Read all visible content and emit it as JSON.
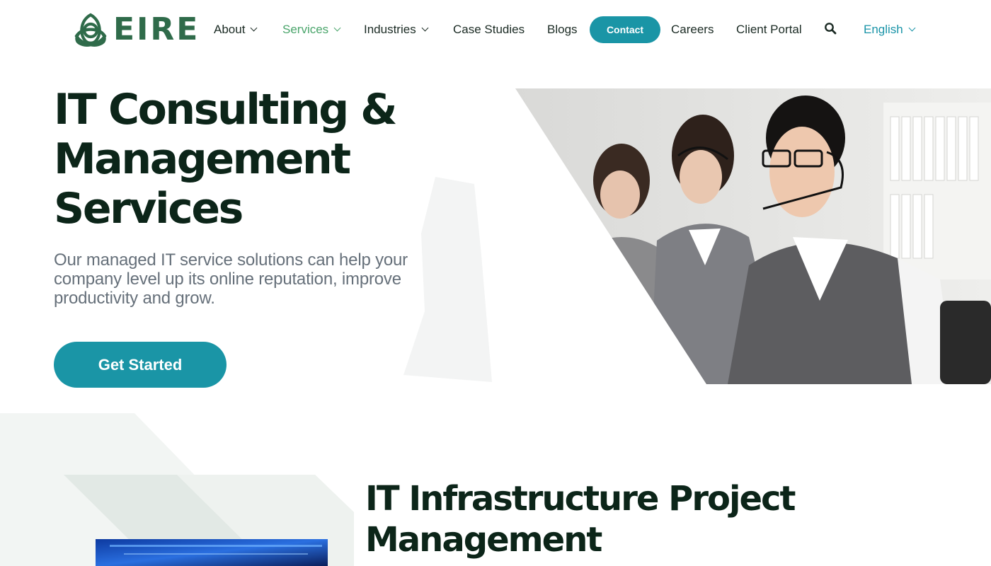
{
  "brand": {
    "name": "EIRE"
  },
  "nav": {
    "about": "About",
    "services": "Services",
    "industries": "Industries",
    "case_studies": "Case Studies",
    "blogs": "Blogs",
    "contact": "Contact",
    "careers": "Careers",
    "client_portal": "Client Portal",
    "language": "English"
  },
  "icons": {
    "search": "search-icon",
    "dropdown": "chevron-down-icon",
    "logo": "celtic-knot-icon"
  },
  "hero": {
    "title_lines": [
      "IT Consulting &",
      "Management",
      "Services"
    ],
    "subtitle": "Our managed IT service solutions can help your company level up its online reputation, improve productivity and grow.",
    "cta": "Get Started"
  },
  "section2": {
    "title_lines": [
      "IT Infrastructure Project",
      "Management"
    ]
  },
  "colors": {
    "brand_green": "#2f6b4a",
    "accent_teal": "#1a95a6",
    "active_nav": "#4aa56b",
    "heading": "#0c2519",
    "body_text": "#66707a"
  }
}
